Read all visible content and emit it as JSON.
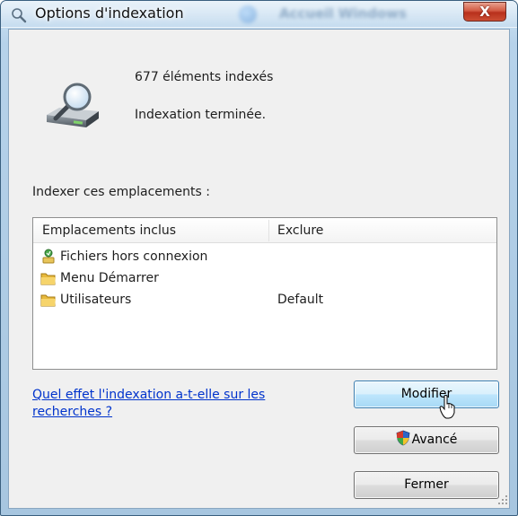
{
  "window": {
    "title": "Options d'indexation",
    "close_label": "X",
    "background_window_title": "Accueil Windows"
  },
  "summary": {
    "count_text": "677 éléments indexés",
    "status_text": "Indexation terminée."
  },
  "locations": {
    "section_label": "Indexer ces emplacements :",
    "columns": {
      "included": "Emplacements inclus",
      "exclude": "Exclure"
    },
    "rows": [
      {
        "name": "Fichiers hors connexion",
        "exclude": "",
        "icon": "offline-files-icon"
      },
      {
        "name": "Menu Démarrer",
        "exclude": "",
        "icon": "folder-icon"
      },
      {
        "name": "Utilisateurs",
        "exclude": "Default",
        "icon": "folder-icon"
      }
    ]
  },
  "help_link": "Quel effet l'indexation a-t-elle sur les recherches ?",
  "buttons": {
    "modify": "Modifier",
    "advanced": "Avancé",
    "close": "Fermer"
  },
  "colors": {
    "link": "#0033cc",
    "title_bar": "#b6d2ea",
    "close_button": "#c9432b",
    "hot_button": "#bee6fd"
  }
}
